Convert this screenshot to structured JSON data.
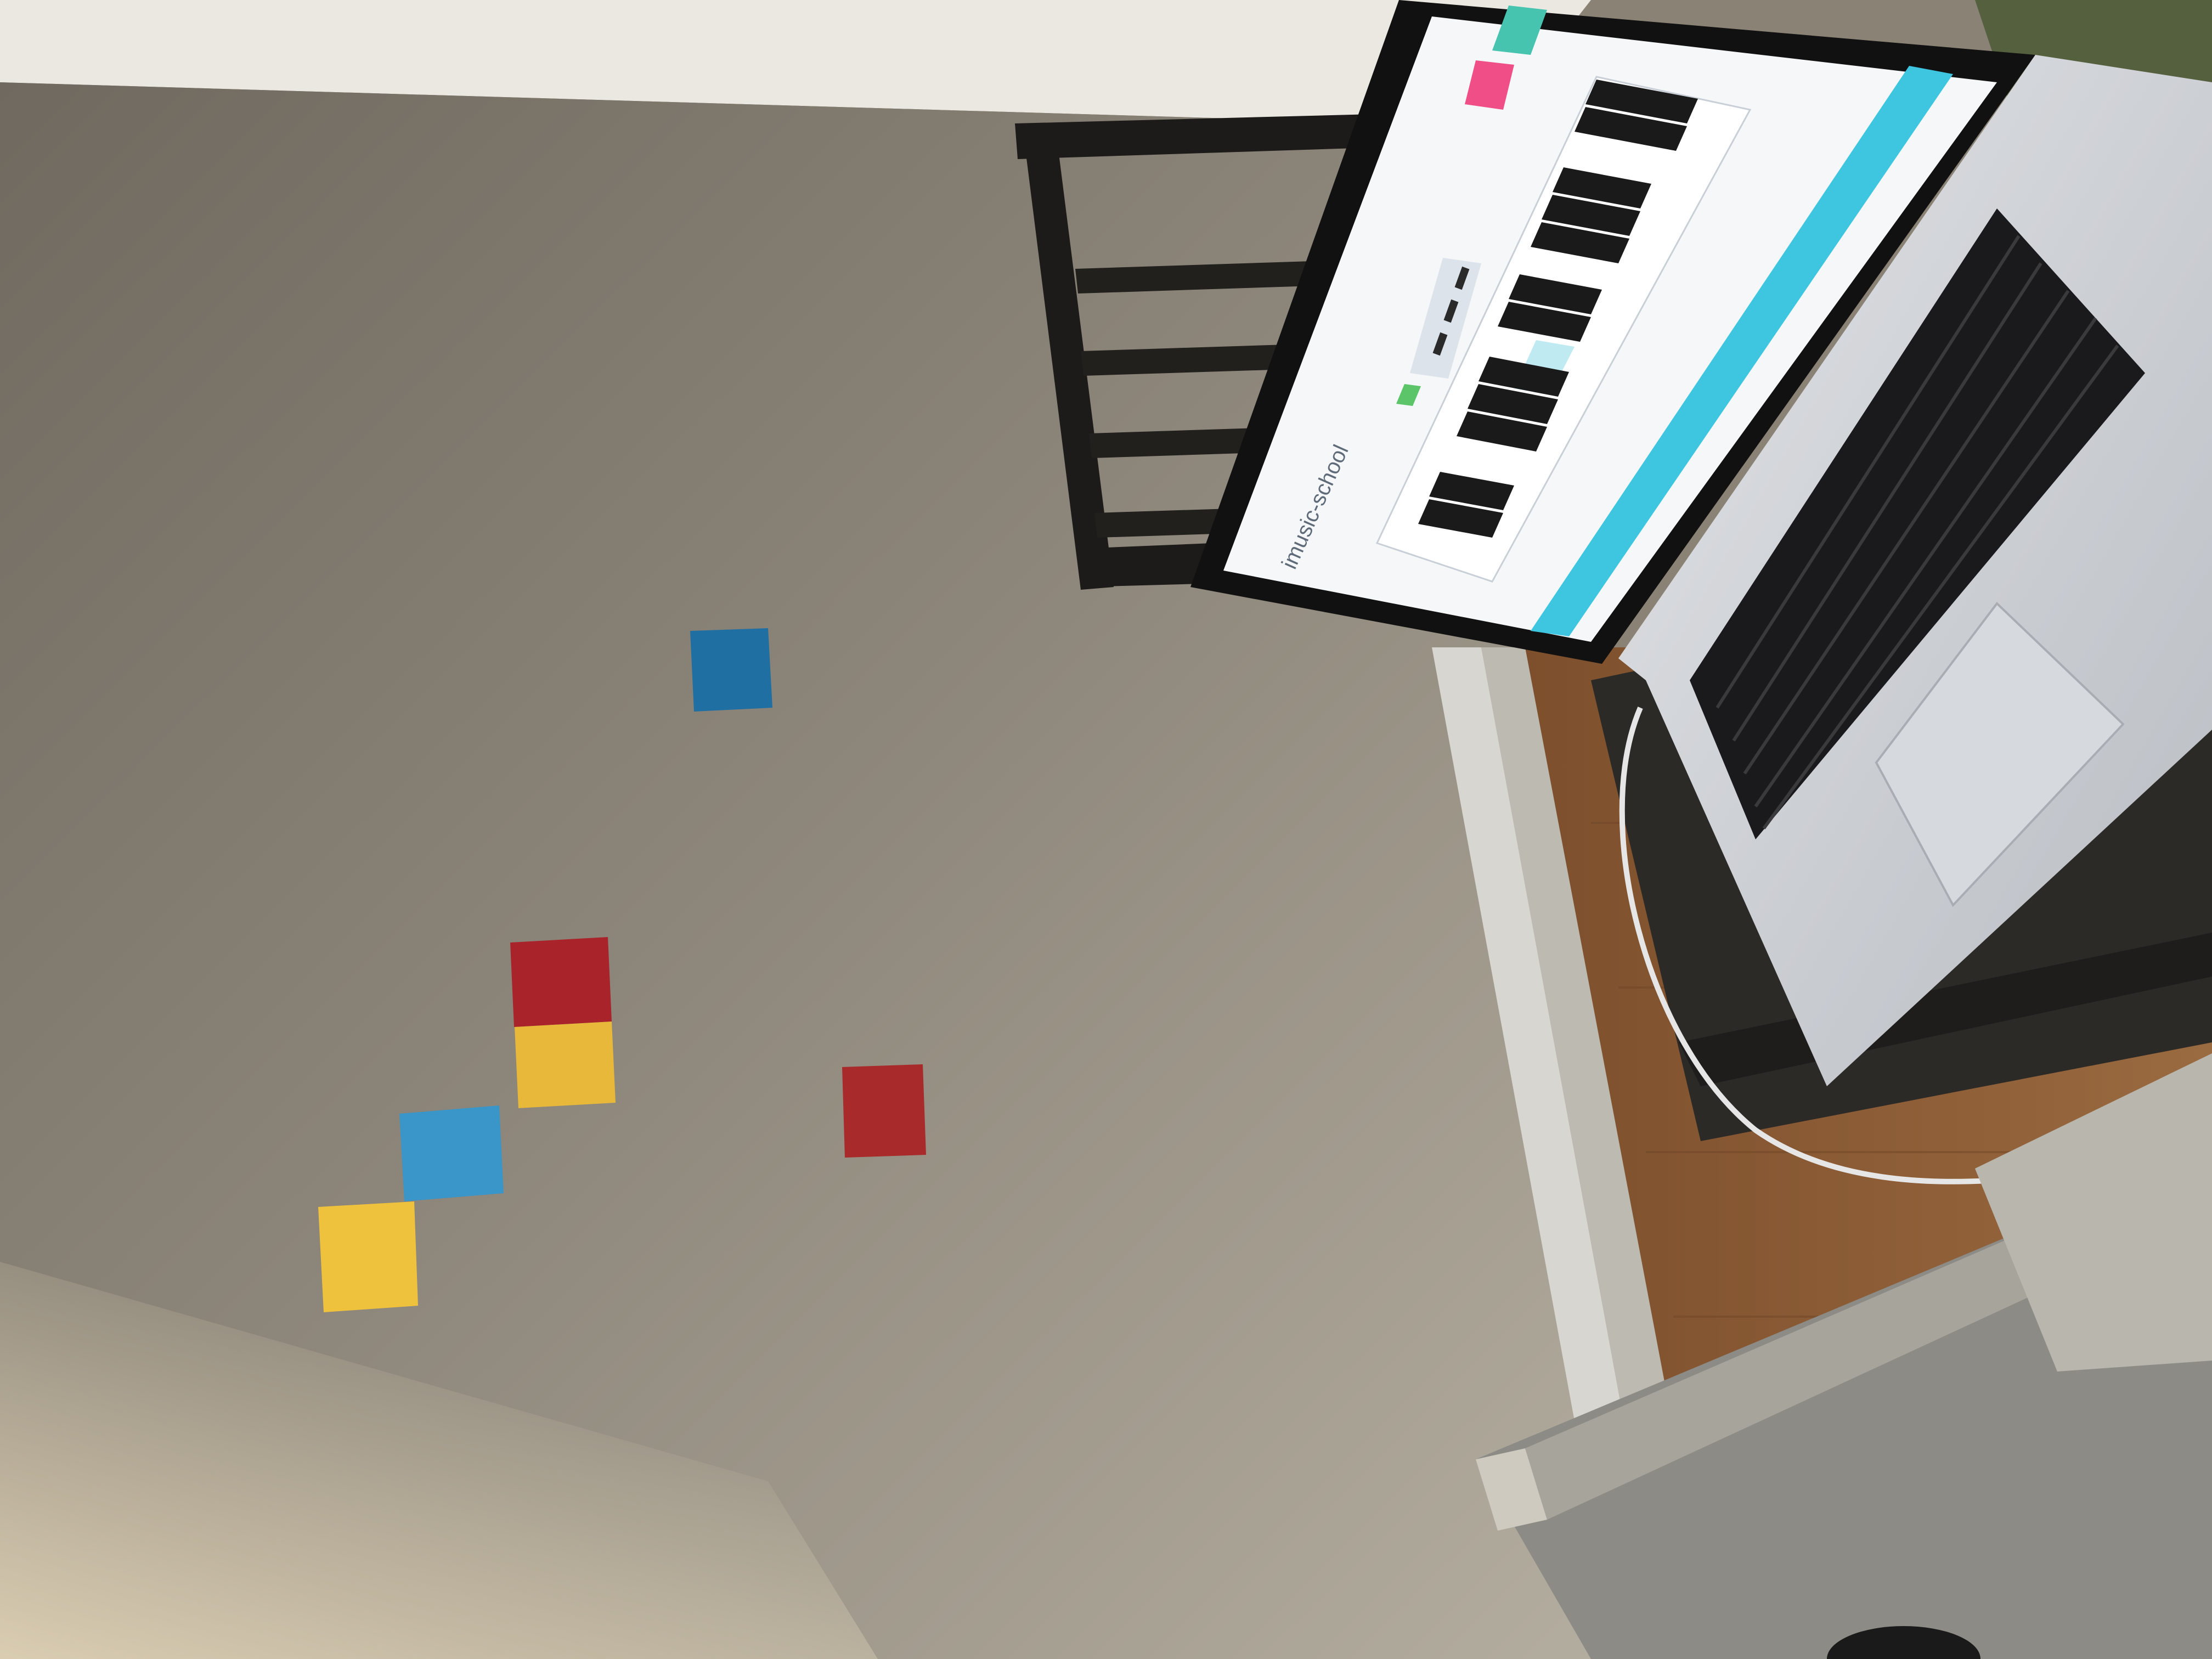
{
  "scene": {
    "description_free": true,
    "wall_color": "#8d8679",
    "ceiling_color": "#e9e6df",
    "floor_color": "#8a5a33",
    "baseboard_color": "#d8d6d0"
  },
  "sticky_notes": [
    {
      "color_name": "blue",
      "color": "#1f6fa3"
    },
    {
      "color_name": "red",
      "color": "#a9232a"
    },
    {
      "color_name": "yellow",
      "color": "#e8b83a"
    },
    {
      "color_name": "blue",
      "color": "#3a95c9"
    },
    {
      "color_name": "yellow",
      "color": "#efc23e"
    },
    {
      "color_name": "red",
      "color": "#a82a2a"
    }
  ],
  "laptop": {
    "body_color": "#c9ccd1",
    "screen": {
      "site_logo": "imusic-school",
      "accent": "#3ec6e0",
      "button_pink": "#ef4f86",
      "button_teal": "#47c4b0",
      "button_green": "#5cc469"
    }
  }
}
